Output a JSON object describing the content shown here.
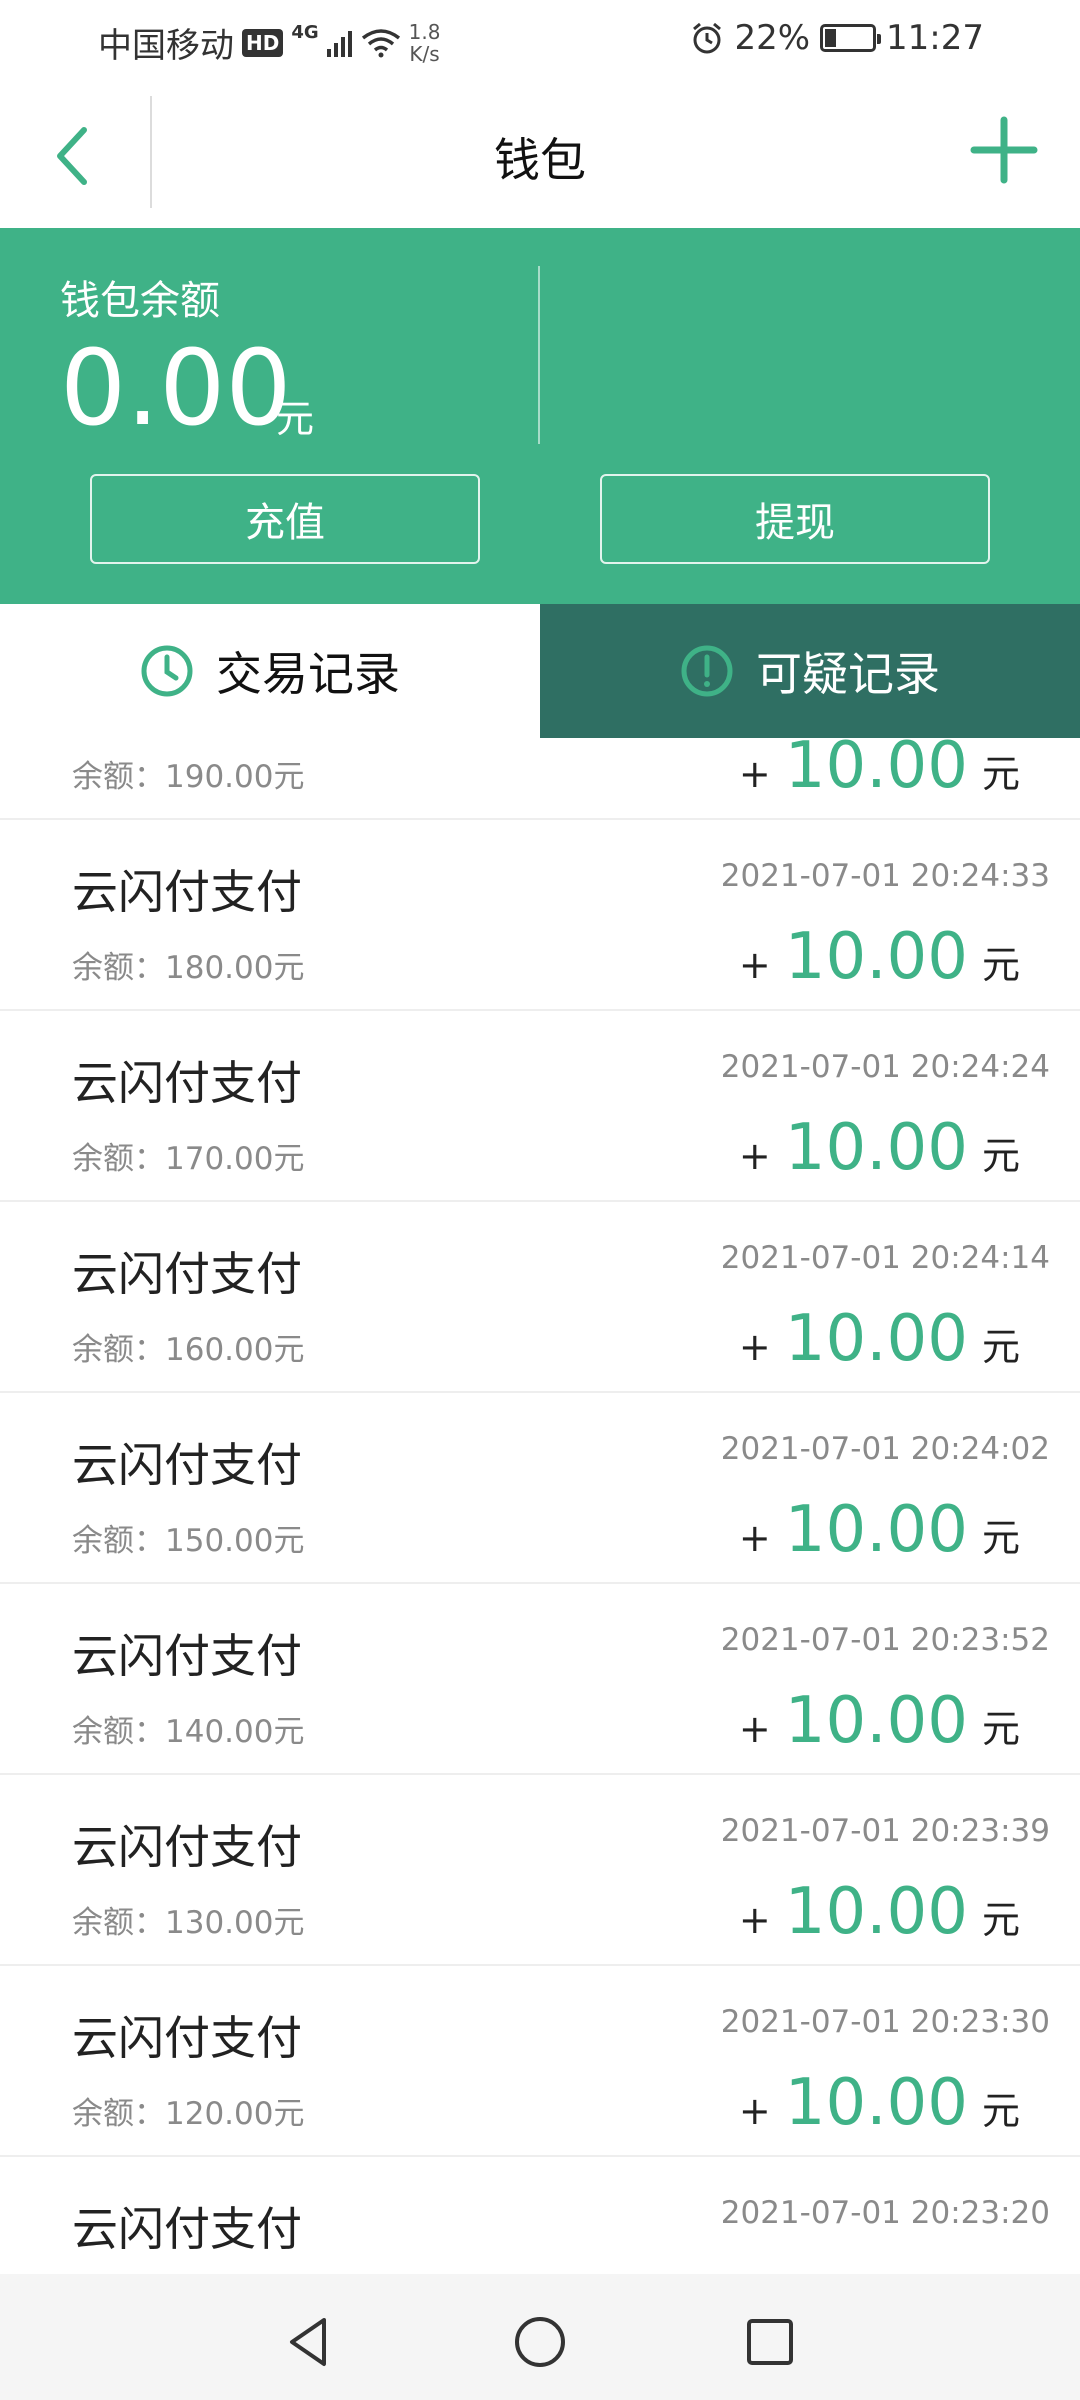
{
  "status_bar": {
    "carrier": "中国移动",
    "hd": "HD",
    "network": "4G",
    "speed_value": "1.8",
    "speed_unit": "K/s",
    "battery": "22%",
    "battery_level": 0.22,
    "time": "11:27"
  },
  "header": {
    "title": "钱包",
    "back_icon": "chevron-left-icon",
    "add_icon": "plus-icon"
  },
  "balance": {
    "label": "钱包余额",
    "amount": "0.00",
    "unit": "元",
    "recharge_label": "充值",
    "withdraw_label": "提现"
  },
  "tabs": [
    {
      "label": "交易记录",
      "icon": "clock-icon",
      "active": true
    },
    {
      "label": "可疑记录",
      "icon": "alert-circle-icon",
      "active": false
    }
  ],
  "transactions": [
    {
      "name": "",
      "time": "",
      "balance": "余额：190.00元",
      "sign": "+",
      "amount": "10.00",
      "unit": "元"
    },
    {
      "name": "云闪付支付",
      "time": "2021-07-01 20:24:33",
      "balance": "余额：180.00元",
      "sign": "+",
      "amount": "10.00",
      "unit": "元"
    },
    {
      "name": "云闪付支付",
      "time": "2021-07-01 20:24:24",
      "balance": "余额：170.00元",
      "sign": "+",
      "amount": "10.00",
      "unit": "元"
    },
    {
      "name": "云闪付支付",
      "time": "2021-07-01 20:24:14",
      "balance": "余额：160.00元",
      "sign": "+",
      "amount": "10.00",
      "unit": "元"
    },
    {
      "name": "云闪付支付",
      "time": "2021-07-01 20:24:02",
      "balance": "余额：150.00元",
      "sign": "+",
      "amount": "10.00",
      "unit": "元"
    },
    {
      "name": "云闪付支付",
      "time": "2021-07-01 20:23:52",
      "balance": "余额：140.00元",
      "sign": "+",
      "amount": "10.00",
      "unit": "元"
    },
    {
      "name": "云闪付支付",
      "time": "2021-07-01 20:23:39",
      "balance": "余额：130.00元",
      "sign": "+",
      "amount": "10.00",
      "unit": "元"
    },
    {
      "name": "云闪付支付",
      "time": "2021-07-01 20:23:30",
      "balance": "余额：120.00元",
      "sign": "+",
      "amount": "10.00",
      "unit": "元"
    },
    {
      "name": "云闪付支付",
      "time": "2021-07-01 20:23:20",
      "balance": "",
      "sign": "",
      "amount": "",
      "unit": ""
    }
  ],
  "nav_bar": {
    "back_icon": "triangle-back-icon",
    "home_icon": "circle-home-icon",
    "recents_icon": "square-recents-icon"
  },
  "colors": {
    "accent": "#3fb287",
    "tab_dark": "#2f6f63"
  }
}
